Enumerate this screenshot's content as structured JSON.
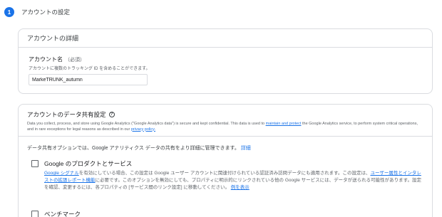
{
  "step": {
    "number": "1",
    "title": "アカウントの設定"
  },
  "account_details": {
    "title": "アカウントの詳細",
    "name_label": "アカウント名",
    "name_required": "（必須）",
    "name_help": "アカウントに複数のトラッキング ID を含めることができます。",
    "name_value": "MarkeTRUNK_autumn"
  },
  "data_sharing": {
    "title": "アカウントのデータ共有設定",
    "desc_part1": "Data you collect, process, and store using Google Analytics (\"Google Analytics data\") is secure and kept confidential. This data is used to ",
    "desc_link1": "maintain and protect",
    "desc_part2": " the Google Analytics service, to perform system critical operations, and in rare exceptions for legal reasons as described in our ",
    "desc_link2": "privacy policy.",
    "intro": "データ共有オプションでは、Google アナリティクス データの共有をより詳細に管理できます。",
    "intro_link": "詳細",
    "options": [
      {
        "title": "Google のプロダクトとサービス",
        "link1": "Google シグナル",
        "text1": "を有効にしている場合、この設定は Google ユーザー アカウントに関連付けられている認証済み訪問データにも適用されます。この設定は、",
        "link2": "ユーザー属性とインタレストの拡張レポート機能",
        "text2": "に必要です。このオプションを無効にしても、プロパティに明示的にリンクされている他の Google サービスには、データが送られる可能性があります。設定を確認、変更するには、各プロパティの [サービス間のリンク設定] に移動してください。",
        "link3": "例を表示"
      },
      {
        "title": "ベンチマーク"
      }
    ]
  }
}
